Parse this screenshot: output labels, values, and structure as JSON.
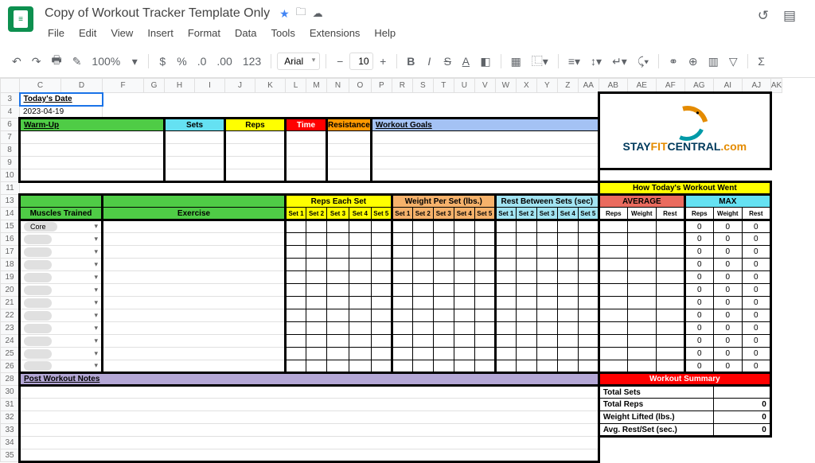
{
  "doc": {
    "title": "Copy of Workout Tracker Template Only"
  },
  "menus": [
    "File",
    "Edit",
    "View",
    "Insert",
    "Format",
    "Data",
    "Tools",
    "Extensions",
    "Help"
  ],
  "toolbar": {
    "zoom": "100%",
    "font": "Arial",
    "size": "10"
  },
  "cols": [
    "C",
    "D",
    "F",
    "G",
    "H",
    "I",
    "J",
    "K",
    "L",
    "M",
    "N",
    "O",
    "P",
    "R",
    "S",
    "T",
    "U",
    "V",
    "W",
    "X",
    "Y",
    "Z",
    "AA",
    "AB",
    "AE",
    "AF",
    "AG",
    "AI",
    "AJ",
    "AK"
  ],
  "rows": [
    "3",
    "4",
    "6",
    "7",
    "8",
    "9",
    "10",
    "11",
    "13",
    "14",
    "15",
    "16",
    "17",
    "18",
    "19",
    "20",
    "21",
    "22",
    "23",
    "24",
    "25",
    "26",
    "28",
    "30",
    "31",
    "32",
    "33",
    "34",
    "35"
  ],
  "labels": {
    "todaysDate": "Today's Date",
    "dateVal": "2023-04-19",
    "warmup": "Warm-Up",
    "sets": "Sets",
    "reps": "Reps",
    "time": "Time",
    "resistance": "Resistance",
    "goals": "Workout Goals",
    "howWent": "How Today's Workout Went",
    "average": "AVERAGE",
    "max": "MAX",
    "muscles": "Muscles Trained",
    "exercise": "Exercise",
    "repsEach": "Reps Each Set",
    "weightPer": "Weight Per Set (lbs.)",
    "restBetween": "Rest Between Sets (sec)",
    "set1": "Set 1",
    "set2": "Set 2",
    "set3": "Set 3",
    "set4": "Set 4",
    "set5": "Set 5",
    "hReps": "Reps",
    "hWeight": "Weight",
    "hRest": "Rest",
    "core": "Core",
    "zero": "0",
    "postNotes": "Post Workout Notes",
    "summary": "Workout Summary",
    "totalSets": "Total Sets",
    "totalReps": "Total Reps",
    "weightLifted": "Weight Lifted (lbs.)",
    "avgRest": "Avg. Rest/Set (sec.)"
  },
  "colors": {
    "green": "#4fcc46",
    "cyan": "#65e1f2",
    "yellow": "#ffff00",
    "red": "#ff0000",
    "orange": "#ff9900",
    "lblue": "#a4c2f4",
    "dorange": "#f6b26b",
    "ltcyan": "#a2e4f2",
    "coral": "#ea6b5e",
    "purple": "#b4a7d6"
  }
}
